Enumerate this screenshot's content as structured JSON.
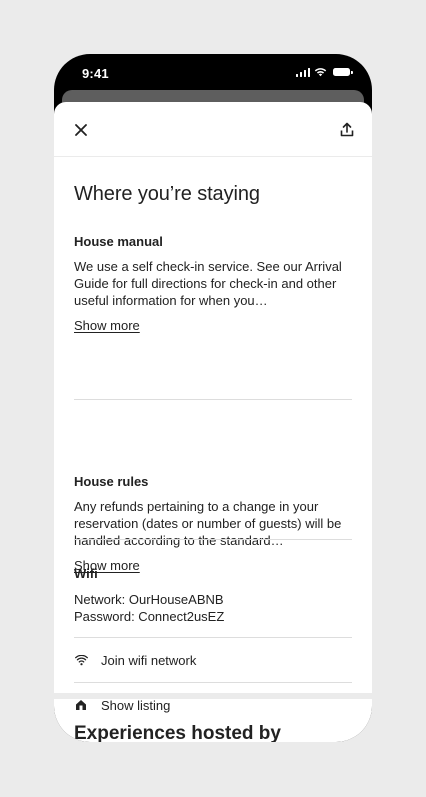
{
  "status_bar": {
    "time": "9:41"
  },
  "header": {
    "close_icon": "close-icon",
    "share_icon": "share-icon"
  },
  "page": {
    "title": "Where you’re staying"
  },
  "house_manual": {
    "heading": "House manual",
    "body": "We use a self check-in service. See our Arrival Guide for full directions for check-in and other useful information for when you…",
    "show_more": "Show more"
  },
  "house_rules": {
    "heading": "House rules",
    "body": "Any refunds pertaining to a change in your reservation (dates or number of guests) will be handled according to the standard…",
    "show_more": "Show more"
  },
  "wifi": {
    "heading": "Wifi",
    "network": "Network: OurHouseABNB",
    "password": "Password: Connect2usEZ"
  },
  "actions": [
    {
      "icon": "wifi-icon",
      "label": "Join wifi network"
    },
    {
      "icon": "home-icon",
      "label": "Show listing"
    }
  ],
  "next_section": {
    "title": "Experiences hosted by"
  },
  "colors": {
    "background": "#ebebeb",
    "text": "#222222",
    "divider": "#dddddd",
    "sheet": "#ffffff"
  }
}
